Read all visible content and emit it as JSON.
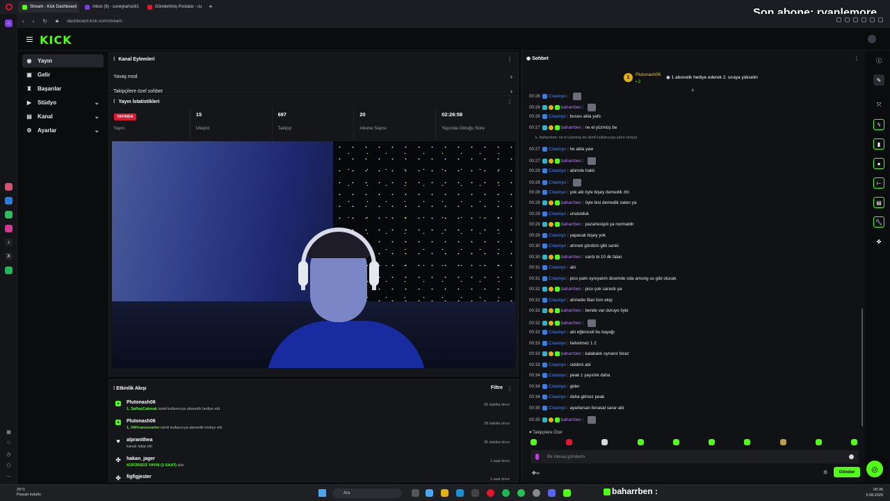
{
  "browser": {
    "tabs": [
      {
        "label": "Stream - Kick Dashboard",
        "color": "#53fc18"
      },
      {
        "label": "Inbox (8) - cuneytartuc81",
        "color": "#7b3fe4"
      },
      {
        "label": "Gönderilmiş Postalar - cu",
        "color": "#e0182d"
      }
    ],
    "new_tab": "+",
    "url": "dashboard.kick.com/stream",
    "overlay_text": "Son abone: ryanlemore"
  },
  "header": {
    "logo": "KICK"
  },
  "nav": {
    "items": [
      {
        "label": "Yayın",
        "icon": "live-icon"
      },
      {
        "label": "Gelir",
        "icon": "revenue-icon"
      },
      {
        "label": "Başarılar",
        "icon": "trophy-icon"
      },
      {
        "label": "Stüdyo",
        "icon": "studio-icon"
      },
      {
        "label": "Kanal",
        "icon": "channel-icon"
      },
      {
        "label": "Ayarlar",
        "icon": "gear-icon"
      }
    ]
  },
  "channel_actions": {
    "title": "Kanal Eylemleri",
    "rows": [
      "Yavaş mod",
      "Takipçilere özel sohbet"
    ]
  },
  "stats": {
    "title": "Yayın İstatistikleri",
    "live_badge": "YAYINDA",
    "items": [
      {
        "value": "",
        "label": "Yayın"
      },
      {
        "value": "15",
        "label": "İzleyici"
      },
      {
        "value": "697",
        "label": "Takipçi"
      },
      {
        "value": "20",
        "label": "Abone Sayısı"
      },
      {
        "value": "02:26:58",
        "label": "Yayında Olduğu Süre"
      }
    ]
  },
  "activity": {
    "title": "Etkinlik Akışı",
    "filter": "Filtre",
    "items": [
      {
        "name": "Plutonash06",
        "highlight": "1, SaffanCakmak",
        "desc": " isimli kullanıcıya abonelik hediye etti.",
        "time": "26 dakika önce",
        "icon": "gift-icon"
      },
      {
        "name": "Plutonash06",
        "highlight": "1, HAYvansevarler",
        "desc": " isimli kullanıcıya abonelik hediye etti.",
        "time": "28 dakika önce",
        "icon": "gift-icon"
      },
      {
        "name": "alpranithea",
        "highlight": "",
        "desc": "kanalı takip etti",
        "time": "36 dakika önce",
        "icon": "heart-icon"
      },
      {
        "name": "hakan_jager",
        "highlight": "KÜFÜRSÜZ YAYIN (1 SAAT)",
        "desc": " aldı",
        "time": "1 saat önce",
        "icon": "reward-icon"
      },
      {
        "name": "figfigjester",
        "highlight": "",
        "desc": "",
        "time": "1 saat önce",
        "icon": "reward-icon"
      }
    ]
  },
  "chat": {
    "title": "Sohbet",
    "pinned": {
      "rank": "1",
      "name": "Plutonash06",
      "count": "2",
      "text": "1 abonelik hediye ederek 2. sıraya yükselin"
    },
    "messages": [
      {
        "time": "00:26",
        "user": "Crasinyo",
        "text": "",
        "type": "c",
        "emote": true
      },
      {
        "time": "00:26",
        "user": "baharrben",
        "text": "",
        "type": "b",
        "emote": true
      },
      {
        "time": "00:26",
        "user": "Crasinyo",
        "text": "burası akla yattı",
        "type": "c"
      },
      {
        "time": "00:27",
        "user": "baharrben",
        "text": "ne el yüzmüş be",
        "type": "b"
      },
      {
        "time": "",
        "user": "",
        "text": "baharrben: ne el yüzmüş be isimli kullanıcıya yanıt veriyor",
        "type": "reply"
      },
      {
        "time": "00:27",
        "user": "Crasinyo",
        "text": "he abla yaw",
        "type": "c"
      },
      {
        "time": "00:27",
        "user": "baharrben",
        "text": "",
        "type": "b",
        "emote": true
      },
      {
        "time": "00:28",
        "user": "Crasinyo",
        "text": "abimde haklı",
        "type": "c"
      },
      {
        "time": "00:28",
        "user": "Crasinyo",
        "text": "",
        "type": "c",
        "emote": true
      },
      {
        "time": "00:28",
        "user": "Crasinyo",
        "text": "yok abi öyle bişey demedik ztn",
        "type": "c"
      },
      {
        "time": "00:28",
        "user": "baharrben",
        "text": "öyle bisi demedik zaten ya",
        "type": "b"
      },
      {
        "time": "00:29",
        "user": "Crasinyo",
        "text": "unutulduk",
        "type": "c"
      },
      {
        "time": "00:29",
        "user": "baharrben",
        "text": "pazartesiydi ya normaldir",
        "type": "b"
      },
      {
        "time": "00:29",
        "user": "Crasinyo",
        "text": "yapacak bişey yok",
        "type": "c"
      },
      {
        "time": "00:30",
        "user": "Crasinyo",
        "text": "ahmeti gördüm gibi sanki",
        "type": "c"
      },
      {
        "time": "00:30",
        "user": "baharrben",
        "text": "vardı bi 10 dk falan",
        "type": "b"
      },
      {
        "time": "00:31",
        "user": "Crasinyo",
        "text": "abi",
        "type": "c"
      },
      {
        "time": "00:31",
        "user": "Crasinyo",
        "text": "pico park oynıyalım dicemde oda among us gibi olucak",
        "type": "c"
      },
      {
        "time": "00:32",
        "user": "baharrben",
        "text": "pico çok sarardı ya",
        "type": "b"
      },
      {
        "time": "00:32",
        "user": "Crasinyo",
        "text": "ahmetle filan tüm ekip",
        "type": "c"
      },
      {
        "time": "00:32",
        "user": "baharrben",
        "text": "bende var duruyo öyle",
        "type": "b"
      },
      {
        "time": "00:32",
        "user": "baharrben",
        "text": "",
        "type": "b",
        "emote": true
      },
      {
        "time": "00:32",
        "user": "Crasinyo",
        "text": "abi eğlenceli bu bayağı",
        "type": "c"
      },
      {
        "time": "00:33",
        "user": "Crasinyo",
        "text": "farketmez 1 2",
        "type": "c"
      },
      {
        "time": "00:33",
        "user": "baharrben",
        "text": "kalabalık oynanır biraz",
        "type": "b"
      },
      {
        "time": "00:33",
        "user": "Crasinyo",
        "text": "ciddimi abi",
        "type": "c"
      },
      {
        "time": "00:34",
        "user": "Crasinyo",
        "text": "peak 1 yayınlık daha",
        "type": "c"
      },
      {
        "time": "00:34",
        "user": "Crasinyo",
        "text": "gider",
        "type": "c"
      },
      {
        "time": "00:34",
        "user": "Crasinyo",
        "text": "daha gitmez peak",
        "type": "c"
      },
      {
        "time": "00:35",
        "user": "Crasinyo",
        "text": "ayarlarsan fenasal sarar abi",
        "type": "c"
      },
      {
        "time": "00:35",
        "user": "baharrben",
        "text": "",
        "type": "b",
        "emote": true
      }
    ],
    "followers_only": "Takipçilere Özel",
    "input_placeholder": "Bir mesaj gönderin",
    "send": "Gönder"
  },
  "taskbar": {
    "temp": "25°C",
    "weather": "Parçalı bulutlu",
    "search": "Ara",
    "overlay_user": "baharrben :",
    "time": "00:35",
    "date": "5.08.2025"
  }
}
